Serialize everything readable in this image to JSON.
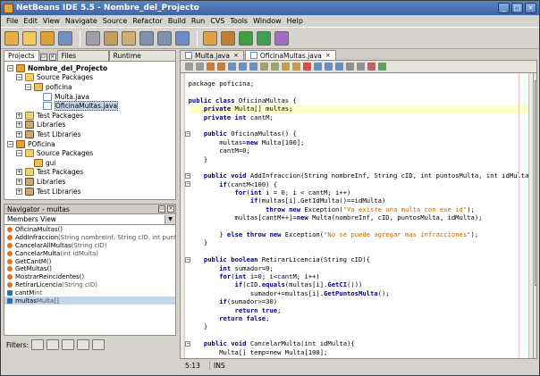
{
  "window": {
    "title": "NetBeans IDE 5.5 - Nombre_del_Projecto"
  },
  "menu": [
    "File",
    "Edit",
    "View",
    "Navigate",
    "Source",
    "Refactor",
    "Build",
    "Run",
    "CVS",
    "Tools",
    "Window",
    "Help"
  ],
  "toolbar_icons": [
    "new-project-icon",
    "new-file-icon",
    "open-project-icon",
    "save-all-icon",
    "cut-icon",
    "copy-icon",
    "paste-icon",
    "undo-icon",
    "redo-icon",
    "find-icon",
    "build-icon",
    "clean-build-icon",
    "run-icon",
    "debug-icon",
    "profile-icon"
  ],
  "projects_panel": {
    "tabs": [
      "Projects",
      "Files",
      "Runtime"
    ],
    "tree": [
      {
        "label": "Nombre_del_Projecto",
        "level": 0,
        "icon": "proj",
        "expanded": true,
        "bold": true
      },
      {
        "label": "Source Packages",
        "level": 1,
        "icon": "folder",
        "expanded": true
      },
      {
        "label": "poficina",
        "level": 2,
        "icon": "pkg",
        "expanded": true
      },
      {
        "label": "Multa.java",
        "level": 3,
        "icon": "java"
      },
      {
        "label": "OficinaMultas.java",
        "level": 3,
        "icon": "java",
        "selected": true
      },
      {
        "label": "Test Packages",
        "level": 1,
        "icon": "folder",
        "expanded": false
      },
      {
        "label": "Libraries",
        "level": 1,
        "icon": "lib",
        "expanded": false
      },
      {
        "label": "Test Libraries",
        "level": 1,
        "icon": "lib",
        "expanded": false
      },
      {
        "label": "POficina",
        "level": 0,
        "icon": "proj",
        "expanded": true
      },
      {
        "label": "Source Packages",
        "level": 1,
        "icon": "folder",
        "expanded": true
      },
      {
        "label": "gui",
        "level": 2,
        "icon": "pkg"
      },
      {
        "label": "Test Packages",
        "level": 1,
        "icon": "folder",
        "expanded": false
      },
      {
        "label": "Libraries",
        "level": 1,
        "icon": "lib",
        "expanded": false
      },
      {
        "label": "Test Libraries",
        "level": 1,
        "icon": "lib",
        "expanded": false
      }
    ]
  },
  "navigator": {
    "title": "Navigator - multas",
    "view": "Members View",
    "members": [
      {
        "name": "OficinaMultas()",
        "sig": "",
        "kind": "meth"
      },
      {
        "name": "AddInfraccion",
        "sig": "(String nombreInf, String cID, int puntosMulta",
        "kind": "meth"
      },
      {
        "name": "CancelarAllMultas",
        "sig": "(String cID)",
        "kind": "meth"
      },
      {
        "name": "CancelarMulta",
        "sig": "(int idMulta)",
        "kind": "meth"
      },
      {
        "name": "GetCantM()",
        "sig": "",
        "kind": "meth"
      },
      {
        "name": "GetMultas()",
        "sig": "",
        "kind": "meth"
      },
      {
        "name": "MostrarReincidentes()",
        "sig": "",
        "kind": "meth"
      },
      {
        "name": "RetirarLicencia",
        "sig": "(String cID)",
        "kind": "meth"
      },
      {
        "name": "cantM",
        "sig": " int",
        "kind": "fld"
      },
      {
        "name": "multas",
        "sig": " Multa[]",
        "kind": "fld",
        "selected": true
      }
    ],
    "filters_label": "Filters:"
  },
  "editor": {
    "tabs": [
      {
        "label": "Multa.java",
        "active": false
      },
      {
        "label": "OficinaMultas.java",
        "active": true
      }
    ],
    "lines": [
      {
        "t": [
          [
            "package poficina;",
            ""
          ]
        ]
      },
      {
        "t": [
          [
            "",
            ""
          ]
        ]
      },
      {
        "t": [
          [
            "public class ",
            "kw"
          ],
          [
            "OficinaMultas {",
            ""
          ]
        ]
      },
      {
        "t": [
          [
            "    private ",
            "kw"
          ],
          [
            "Multa[] multas;",
            ""
          ]
        ],
        "cur": true
      },
      {
        "t": [
          [
            "    private int ",
            "kw"
          ],
          [
            "cantM;",
            ""
          ]
        ]
      },
      {
        "t": [
          [
            "",
            ""
          ]
        ]
      },
      {
        "t": [
          [
            "    public ",
            "kw"
          ],
          [
            "OficinaMultas",
            ""
          ],
          [
            "() {",
            ""
          ]
        ]
      },
      {
        "t": [
          [
            "        multas=",
            ""
          ],
          [
            "new ",
            "kw"
          ],
          [
            "Multa[100];",
            ""
          ]
        ]
      },
      {
        "t": [
          [
            "        cantM=0;",
            ""
          ]
        ]
      },
      {
        "t": [
          [
            "    }",
            ""
          ]
        ]
      },
      {
        "t": [
          [
            "",
            ""
          ]
        ]
      },
      {
        "t": [
          [
            "    public void ",
            "kw"
          ],
          [
            "AddInfraccion(String nombreInf, String cID, int puntosMulta, int idMulta",
            ""
          ]
        ]
      },
      {
        "t": [
          [
            "        if",
            "kw"
          ],
          [
            "(cantM<100) {",
            ""
          ]
        ]
      },
      {
        "t": [
          [
            "            for",
            "kw"
          ],
          [
            "(",
            ""
          ],
          [
            "int ",
            "kw"
          ],
          [
            "i = 0; i < cantM; i++)",
            ""
          ]
        ]
      },
      {
        "t": [
          [
            "                if",
            "kw"
          ],
          [
            "(multas[i].GetIdMulta()==idMulta)",
            ""
          ]
        ]
      },
      {
        "t": [
          [
            "                    throw new ",
            "kw"
          ],
          [
            "Exception(",
            ""
          ],
          [
            "\"Ya existe una multa con ese id\"",
            "str"
          ],
          [
            ");",
            ""
          ]
        ]
      },
      {
        "t": [
          [
            "            multas[cantM++]=",
            ""
          ],
          [
            "new ",
            "kw"
          ],
          [
            "Multa(nombreInf, cID, puntosMulta, idMulta);",
            ""
          ]
        ]
      },
      {
        "t": [
          [
            "",
            ""
          ]
        ]
      },
      {
        "t": [
          [
            "        } ",
            ""
          ],
          [
            "else throw new ",
            "kw"
          ],
          [
            "Exception(",
            ""
          ],
          [
            "\"No se puede agregar mas infracciones\"",
            "str"
          ],
          [
            ");",
            ""
          ]
        ]
      },
      {
        "t": [
          [
            "    }",
            ""
          ]
        ]
      },
      {
        "t": [
          [
            "",
            ""
          ]
        ]
      },
      {
        "t": [
          [
            "    public boolean ",
            "kw"
          ],
          [
            "RetirarLicencia(String cID){",
            ""
          ]
        ]
      },
      {
        "t": [
          [
            "        int ",
            "kw"
          ],
          [
            "sumador=0;",
            ""
          ]
        ]
      },
      {
        "t": [
          [
            "        for",
            "kw"
          ],
          [
            "(",
            ""
          ],
          [
            "int ",
            "kw"
          ],
          [
            "i=0; i<cantM; i++)",
            ""
          ]
        ]
      },
      {
        "t": [
          [
            "            if",
            "kw"
          ],
          [
            "(cID.",
            ""
          ],
          [
            "equals",
            "kw"
          ],
          [
            "(multas[i].",
            ""
          ],
          [
            "GetCI",
            "kw"
          ],
          [
            "()))",
            ""
          ]
        ]
      },
      {
        "t": [
          [
            "                sumador+=multas[i].",
            ""
          ],
          [
            "GetPuntosMulta",
            "kw"
          ],
          [
            "();",
            ""
          ]
        ]
      },
      {
        "t": [
          [
            "        if",
            "kw"
          ],
          [
            "(sumador>=30)",
            ""
          ]
        ]
      },
      {
        "t": [
          [
            "            return true",
            "kw"
          ],
          [
            ";",
            ""
          ]
        ]
      },
      {
        "t": [
          [
            "        return false",
            "kw"
          ],
          [
            ";",
            ""
          ]
        ]
      },
      {
        "t": [
          [
            "    }",
            ""
          ]
        ]
      },
      {
        "t": [
          [
            "",
            ""
          ]
        ]
      },
      {
        "t": [
          [
            "    public void ",
            "kw"
          ],
          [
            "CancelarMulta(int idMulta){",
            ""
          ]
        ]
      },
      {
        "t": [
          [
            "        Multa[] temp=new Multa[100];",
            ""
          ]
        ]
      }
    ]
  },
  "status": {
    "position": "5:13",
    "mode": "INS"
  }
}
